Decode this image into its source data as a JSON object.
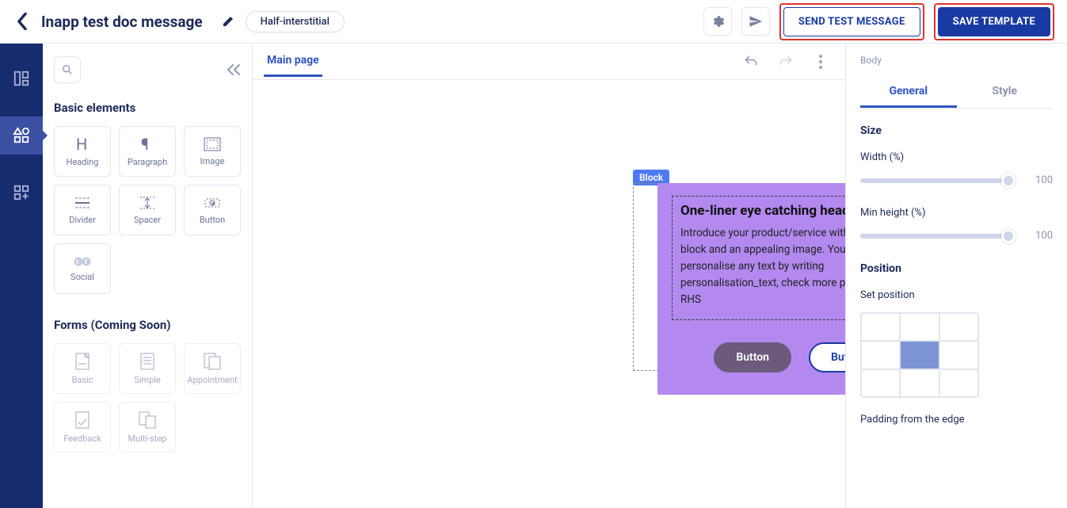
{
  "header": {
    "title": "Inapp test doc message",
    "layout_badge": "Half-interstitial",
    "send_test_label": "SEND TEST MESSAGE",
    "save_label": "SAVE TEMPLATE"
  },
  "sidebar": {
    "basic_title": "Basic elements",
    "basic": [
      {
        "label": "Heading"
      },
      {
        "label": "Paragraph"
      },
      {
        "label": "Image"
      },
      {
        "label": "Divider"
      },
      {
        "label": "Spacer"
      },
      {
        "label": "Button"
      },
      {
        "label": "Social"
      }
    ],
    "forms_title": "Forms (Coming Soon)",
    "forms": [
      {
        "label": "Basic"
      },
      {
        "label": "Simple"
      },
      {
        "label": "Appointment"
      },
      {
        "label": "Feedback"
      },
      {
        "label": "Multi-step"
      }
    ]
  },
  "canvas": {
    "tab_label": "Main page",
    "block_label": "Block",
    "heading": "One-liner eye catching heading",
    "body": "Introduce your product/service with an interactive block and an appealing image. You can personalise any text by writing personalisation_text, check more properties on RHS",
    "button1": "Button",
    "button2": "Button"
  },
  "props": {
    "crumb": "Body",
    "tab_general": "General",
    "tab_style": "Style",
    "size_title": "Size",
    "width_label": "Width (%)",
    "width_value": "100",
    "minheight_label": "Min height (%)",
    "minheight_value": "100",
    "position_title": "Position",
    "setpos_label": "Set position",
    "padding_label": "Padding from the edge"
  }
}
